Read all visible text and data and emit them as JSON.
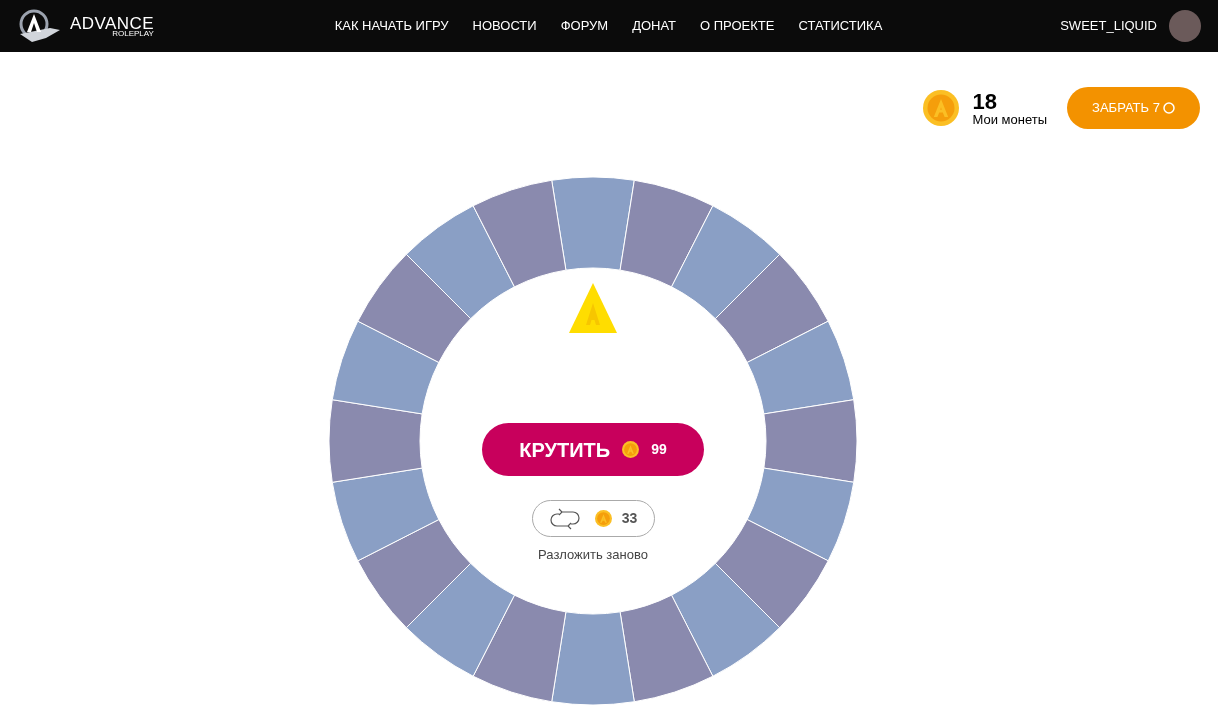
{
  "header": {
    "logo_text": "ADVANCE",
    "logo_subtext": "ROLEPLAY",
    "nav": [
      {
        "label": "КАК НАЧАТЬ ИГРУ"
      },
      {
        "label": "НОВОСТИ"
      },
      {
        "label": "ФОРУМ"
      },
      {
        "label": "ДОНАТ"
      },
      {
        "label": "О ПРОЕКТЕ"
      },
      {
        "label": "СТАТИСТИКА"
      }
    ],
    "username": "SWEET_LIQUID"
  },
  "balance": {
    "amount": "18",
    "label": "Мои монеты",
    "claim_button": "ЗАБРАТЬ 7"
  },
  "wheel": {
    "spin_button": {
      "label": "КРУТИТЬ",
      "cost": "99"
    },
    "reshuffle_button": {
      "cost": "33"
    },
    "reshuffle_label": "Разложить заново"
  }
}
